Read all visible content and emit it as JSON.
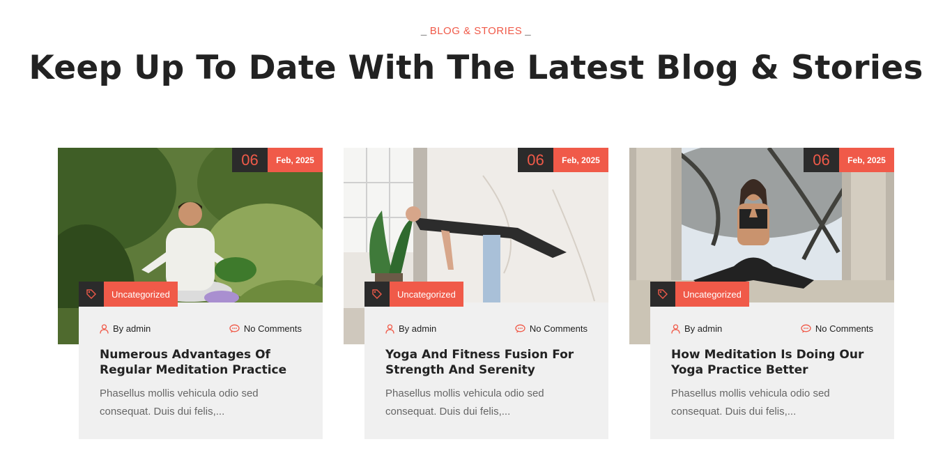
{
  "section": {
    "tag": "BLOG & STORIES",
    "title": "Keep Up To Date With The Latest Blog & Stories"
  },
  "colors": {
    "accent": "#f05a49",
    "dark": "#2b2b2b",
    "card_bg": "#f0f0f0"
  },
  "icons": {
    "category": "tag-icon",
    "author": "user-icon",
    "comments": "comment-icon"
  },
  "posts": [
    {
      "day": "06",
      "month": "Feb, 2025",
      "category": "Uncategorized",
      "author": "By admin",
      "comments": "No Comments",
      "title": "Numerous Advantages Of Regular Meditation Practice",
      "excerpt": "Phasellus mollis vehicula odio sed consequat. Duis dui felis,..."
    },
    {
      "day": "06",
      "month": "Feb, 2025",
      "category": "Uncategorized",
      "author": "By admin",
      "comments": "No Comments",
      "title": "Yoga And Fitness Fusion For Strength And Serenity",
      "excerpt": "Phasellus mollis vehicula odio sed consequat. Duis dui felis,..."
    },
    {
      "day": "06",
      "month": "Feb, 2025",
      "category": "Uncategorized",
      "author": "By admin",
      "comments": "No Comments",
      "title": "How Meditation Is Doing Our Yoga Practice Better",
      "excerpt": "Phasellus mollis vehicula odio sed consequat. Duis dui felis,..."
    }
  ]
}
